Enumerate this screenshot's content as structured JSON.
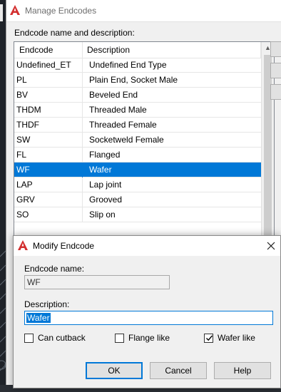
{
  "main_window": {
    "title": "Manage Endcodes",
    "section_label": "Endcode name and description:",
    "columns": [
      "Endcode",
      "Description"
    ],
    "rows": [
      {
        "code": "Undefined_ET",
        "description": "Undefined End Type"
      },
      {
        "code": "PL",
        "description": "Plain End, Socket Male"
      },
      {
        "code": "BV",
        "description": "Beveled End"
      },
      {
        "code": "THDM",
        "description": "Threaded Male"
      },
      {
        "code": "THDF",
        "description": "Threaded Female"
      },
      {
        "code": "SW",
        "description": "Socketweld Female"
      },
      {
        "code": "FL",
        "description": "Flanged"
      },
      {
        "code": "WF",
        "description": "Wafer"
      },
      {
        "code": "LAP",
        "description": "Lap joint"
      },
      {
        "code": "GRV",
        "description": "Grooved"
      },
      {
        "code": "SO",
        "description": "Slip on"
      }
    ],
    "selected_row": "WF"
  },
  "dialog": {
    "title": "Modify Endcode",
    "name_label": "Endcode name:",
    "name_value": "WF",
    "description_label": "Description:",
    "description_value": "Wafer",
    "checkboxes": [
      {
        "label": "Can cutback",
        "checked": false
      },
      {
        "label": "Flange like",
        "checked": false
      },
      {
        "label": "Wafer like",
        "checked": true
      }
    ],
    "buttons": {
      "ok": "OK",
      "cancel": "Cancel",
      "help": "Help"
    }
  },
  "colors": {
    "selection": "#0078d7",
    "app_logo": "#d32f2f"
  },
  "icons": [
    "autocad-logo-icon",
    "close-icon",
    "checkmark-icon",
    "scroll-up-arrow-icon"
  ]
}
